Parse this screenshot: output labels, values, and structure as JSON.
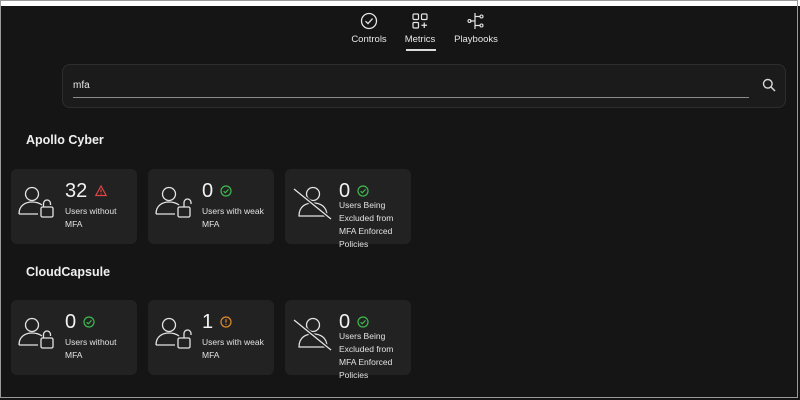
{
  "nav": {
    "tabs": [
      {
        "label": "Controls",
        "icon": "check-circle-icon"
      },
      {
        "label": "Metrics",
        "icon": "grid-plus-icon",
        "active": true
      },
      {
        "label": "Playbooks",
        "icon": "branch-icon"
      }
    ]
  },
  "search": {
    "value": "mfa",
    "placeholder": ""
  },
  "groups": [
    {
      "title": "Apollo Cyber",
      "cards": [
        {
          "value": "32",
          "label": "Users without MFA",
          "status": "warning",
          "status_color": "#e04545"
        },
        {
          "value": "0",
          "label": "Users with weak MFA",
          "status": "ok",
          "status_color": "#3fb950"
        },
        {
          "value": "0",
          "label": "Users Being Excluded from MFA Enforced Policies",
          "status": "ok",
          "status_color": "#3fb950"
        }
      ]
    },
    {
      "title": "CloudCapsule",
      "cards": [
        {
          "value": "0",
          "label": "Users without MFA",
          "status": "ok",
          "status_color": "#3fb950"
        },
        {
          "value": "1",
          "label": "Users with weak MFA",
          "status": "caution",
          "status_color": "#e08a2c"
        },
        {
          "value": "0",
          "label": "Users Being Excluded from MFA Enforced Policies",
          "status": "ok",
          "status_color": "#3fb950"
        }
      ]
    }
  ]
}
